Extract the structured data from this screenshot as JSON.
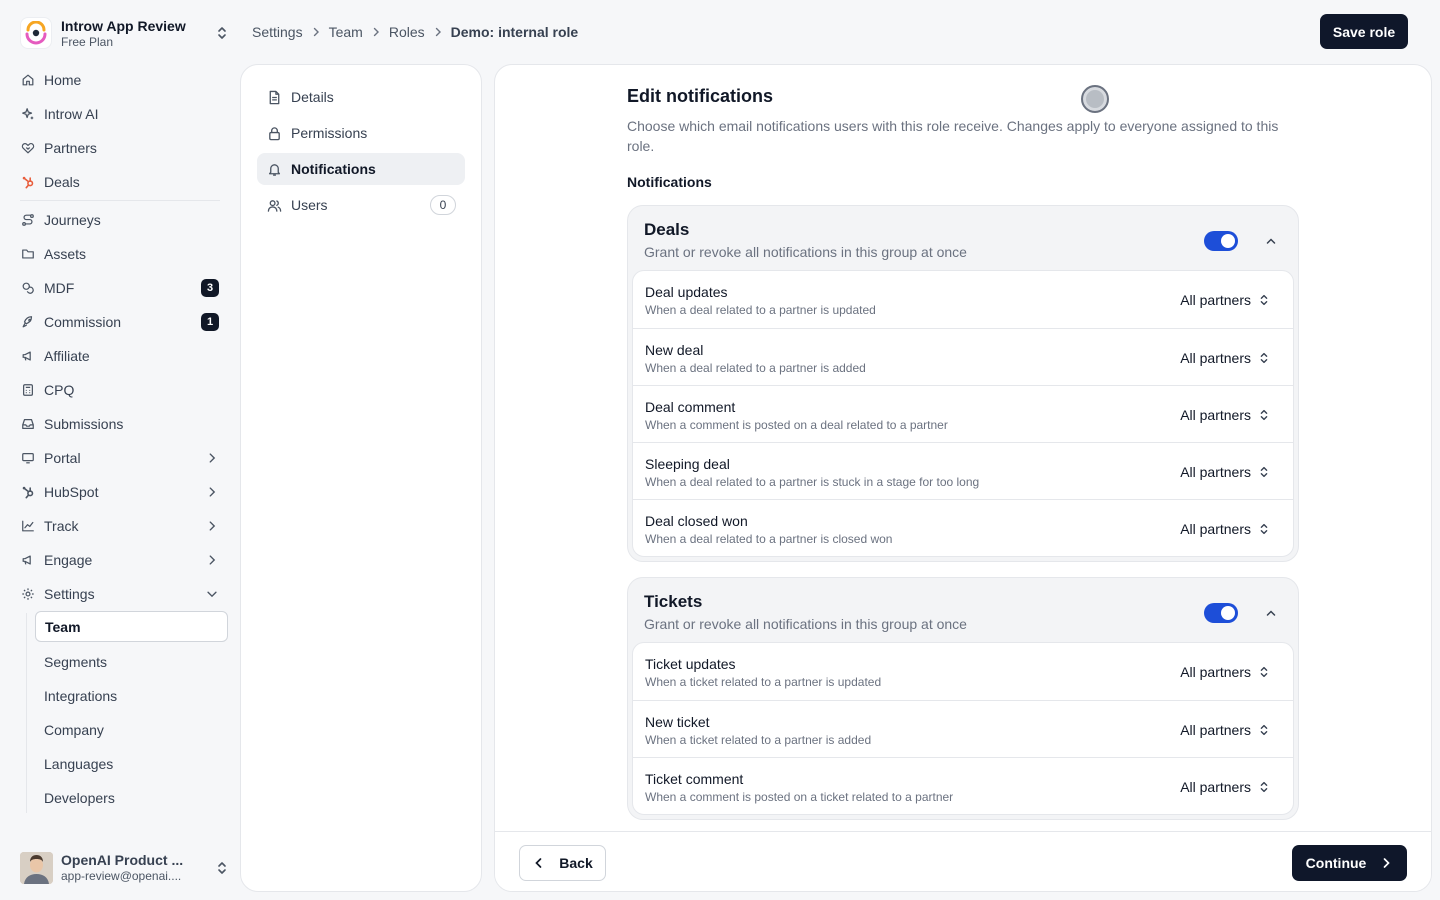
{
  "org": {
    "name": "Introw App Review",
    "plan": "Free Plan"
  },
  "sidebar": {
    "items": [
      {
        "label": "Home",
        "icon": "home-icon"
      },
      {
        "label": "Introw AI",
        "icon": "sparkle-icon"
      },
      {
        "label": "Partners",
        "icon": "handshake-icon"
      },
      {
        "label": "Deals",
        "icon": "hubspot-icon"
      }
    ],
    "items2": [
      {
        "label": "Journeys",
        "icon": "journey-icon"
      },
      {
        "label": "Assets",
        "icon": "folder-icon"
      },
      {
        "label": "MDF",
        "icon": "coins-icon",
        "badge": "3"
      },
      {
        "label": "Commission",
        "icon": "rocket-icon",
        "badge": "1"
      },
      {
        "label": "Affiliate",
        "icon": "megaphone-icon"
      },
      {
        "label": "CPQ",
        "icon": "calculator-icon"
      },
      {
        "label": "Submissions",
        "icon": "inbox-icon"
      },
      {
        "label": "Portal",
        "icon": "monitor-icon"
      },
      {
        "label": "HubSpot",
        "icon": "hubspot-icon"
      },
      {
        "label": "Track",
        "icon": "chart-icon"
      },
      {
        "label": "Engage",
        "icon": "megaphone-icon"
      },
      {
        "label": "Settings",
        "icon": "gear-icon"
      }
    ],
    "settings_sub": [
      "Team",
      "Segments",
      "Integrations",
      "Company",
      "Languages",
      "Developers"
    ]
  },
  "user": {
    "name": "OpenAI Product ...",
    "email": "app-review@openai...."
  },
  "breadcrumb": [
    "Settings",
    "Team",
    "Roles",
    "Demo: internal role"
  ],
  "save_label": "Save role",
  "panel_nav": {
    "items": [
      {
        "label": "Details"
      },
      {
        "label": "Permissions"
      },
      {
        "label": "Notifications"
      },
      {
        "label": "Users",
        "count": "0"
      }
    ]
  },
  "main": {
    "title": "Edit notifications",
    "description": "Choose which email notifications users with this role receive. Changes apply to everyone assigned to this role.",
    "notifications_label": "Notifications",
    "groups": [
      {
        "title": "Deals",
        "subtitle": "Grant or revoke all notifications in this group at once",
        "enabled": true,
        "rows": [
          {
            "title": "Deal updates",
            "desc": "When a deal related to a partner is updated",
            "value": "All partners"
          },
          {
            "title": "New deal",
            "desc": "When a deal related to a partner is added",
            "value": "All partners"
          },
          {
            "title": "Deal comment",
            "desc": "When a comment is posted on a deal related to a partner",
            "value": "All partners"
          },
          {
            "title": "Sleeping deal",
            "desc": "When a deal related to a partner is stuck in a stage for too long",
            "value": "All partners"
          },
          {
            "title": "Deal closed won",
            "desc": "When a deal related to a partner is closed won",
            "value": "All partners"
          }
        ]
      },
      {
        "title": "Tickets",
        "subtitle": "Grant or revoke all notifications in this group at once",
        "enabled": true,
        "rows": [
          {
            "title": "Ticket updates",
            "desc": "When a ticket related to a partner is updated",
            "value": "All partners"
          },
          {
            "title": "New ticket",
            "desc": "When a ticket related to a partner is added",
            "value": "All partners"
          },
          {
            "title": "Ticket comment",
            "desc": "When a comment is posted on a ticket related to a partner",
            "value": "All partners"
          }
        ]
      }
    ]
  },
  "footer": {
    "back_label": "Back",
    "continue_label": "Continue"
  },
  "colors": {
    "primary": "#0f172a",
    "toggle": "#1d4ed8",
    "badge": "#111827",
    "brand_accent": "#e85d3c"
  }
}
